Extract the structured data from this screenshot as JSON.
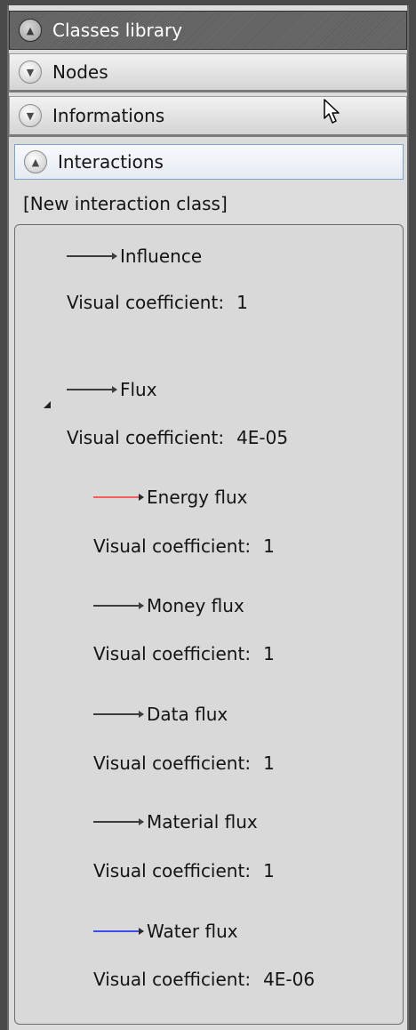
{
  "sections": {
    "classes_library": "Classes library",
    "nodes": "Nodes",
    "informations": "Informations",
    "interactions": "Interactions"
  },
  "new_interaction_class": "[New interaction class]",
  "coefficient_label": "Visual coefficient:",
  "interactions": [
    {
      "name": "Influence",
      "coefficient": "1",
      "arrow_color": "#3c3c3c"
    },
    {
      "name": "Flux",
      "coefficient": "4E-05",
      "arrow_color": "#3c3c3c",
      "expanded": true,
      "children": [
        {
          "name": "Energy flux",
          "coefficient": "1",
          "arrow_color": "#f26060"
        },
        {
          "name": "Money flux",
          "coefficient": "1",
          "arrow_color": "#3c3c3c"
        },
        {
          "name": "Data flux",
          "coefficient": "1",
          "arrow_color": "#3c3c3c"
        },
        {
          "name": "Material flux",
          "coefficient": "1",
          "arrow_color": "#3c3c3c"
        },
        {
          "name": "Water flux",
          "coefficient": "4E-06",
          "arrow_color": "#3a4fe8"
        }
      ]
    }
  ],
  "icons": {
    "collapse": "chevron-up-icon",
    "expand": "chevron-down-icon",
    "expander": "tree-expander-icon",
    "cursor": "mouse-cursor-icon"
  }
}
